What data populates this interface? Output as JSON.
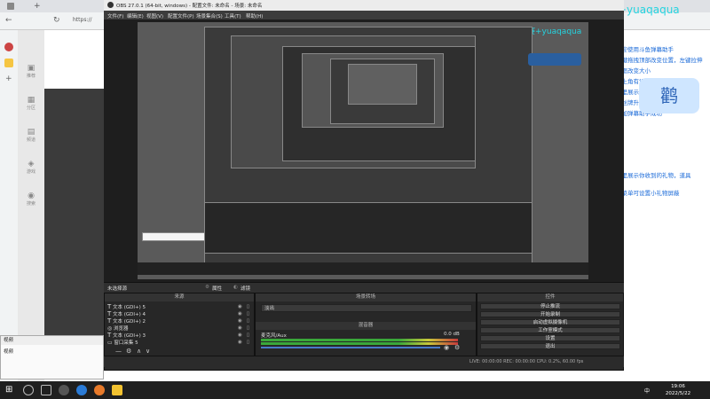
{
  "browser": {
    "address": "https://"
  },
  "obs": {
    "title": "OBS 27.0.1 (64-bit, windows) - 配置文件: 未命名 - 场景: 未命名",
    "menu": [
      "文件(F)",
      "编辑(E)",
      "视图(V)",
      "配置文件(P)",
      "场景集合(S)",
      "工具(T)",
      "帮助(H)"
    ],
    "docks_header": "未选择源",
    "scenes_title": "场景",
    "sources_title": "来源",
    "mixer_title": "混音器",
    "transitions_title": "场景转场",
    "controls_title": "控件",
    "properties_label": "属性",
    "filters_label": "滤镜",
    "transition_value": "淡出",
    "mixer_track": "麦克风/Aux",
    "mixer_db": "0.0 dB",
    "sources": [
      "文本 (GDI+) 5",
      "文本 (GDI+) 4",
      "文本 (GDI+) 2",
      "浏览器",
      "文本 (GDI+) 3",
      "窗口采集 5"
    ],
    "controls": [
      "停止推流",
      "开始录制",
      "启动虚拟摄像机",
      "工作室模式",
      "设置",
      "退出"
    ],
    "status": "LIVE: 00:00:00   REC: 00:00:00   CPU: 0.2%, 60.00 fps"
  },
  "stream_overlay": {
    "watermark": "互鲸粉丝牌大赛+yuaqaqua",
    "watermark2": "互鲸粉丝牌大赛+yuaqaqua",
    "chat": [
      "欢迎使用斗鱼弹幕助手",
      "左键拖拽顶部改变位置，左键拉伸",
      "边框改变大小",
      "右上角有设置菜单",
      "这里展示弹幕，贵族开通/续费，",
      "粉丝牌升级等",
      "添加弹幕助手成功"
    ],
    "gift_lines": [
      "这里展示你收到的礼物，道具",
      "点菜单可设置小礼物屏蔽"
    ],
    "sticker": "鹳"
  },
  "site_nav": [
    "推荐",
    "分区",
    "频道",
    "游戏",
    "搜索"
  ],
  "mini_dialog": {
    "title": "视频",
    "body": "视频"
  },
  "taskbar": {
    "time": "19:06",
    "date": "2022/5/22",
    "lang": "中"
  },
  "colors": {
    "watermark": "#24d4e0",
    "chat": "#1a6ad8",
    "obs_bg": "#2b2b2b"
  }
}
